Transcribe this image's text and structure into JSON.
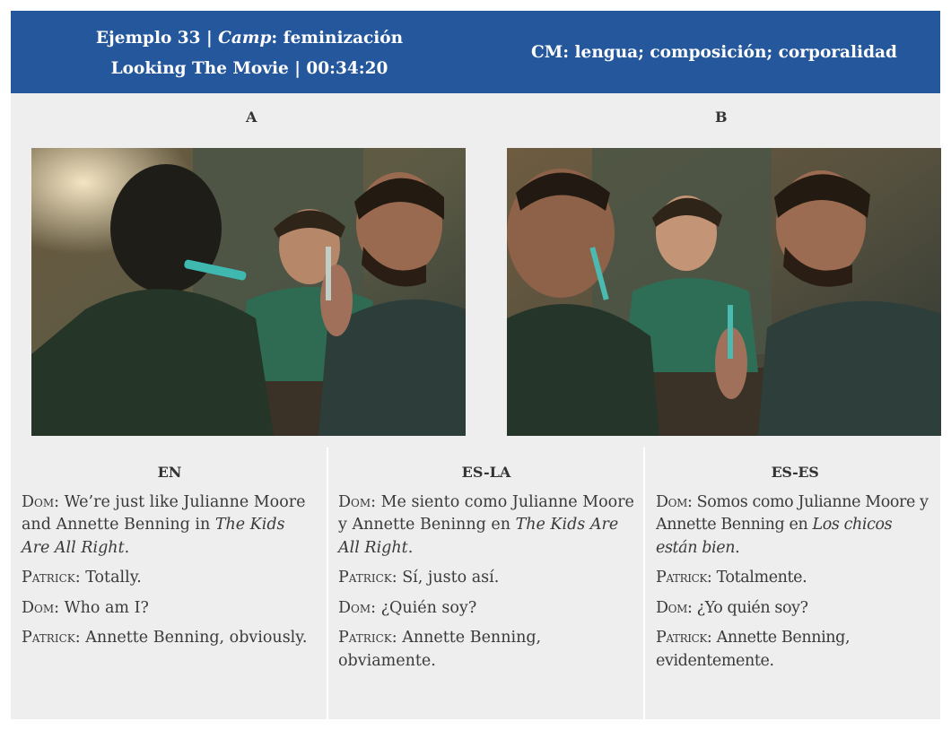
{
  "header": {
    "line1_prefix": "Ejemplo 33 | ",
    "line1_italic": "Camp",
    "line1_suffix": ": feminización",
    "line2": "Looking The Movie | 00:34:20",
    "cm": "CM: lengua; composición; corporalidad"
  },
  "panels": [
    {
      "label": "A"
    },
    {
      "label": "B"
    }
  ],
  "columns": [
    {
      "header": "EN",
      "lines": [
        {
          "speaker": "Dom",
          "text": "We’re just like Julianne Moore and Annette Benning in ",
          "italic": "The Kids Are All Right",
          "end": "."
        },
        {
          "speaker": "Patrick",
          "text": "Totally.",
          "italic": "",
          "end": ""
        },
        {
          "speaker": "Dom",
          "text": "Who am I?",
          "italic": "",
          "end": ""
        },
        {
          "speaker": "Patrick",
          "text": "Annette Benning, obviously.",
          "italic": "",
          "end": ""
        }
      ]
    },
    {
      "header": "ES-LA",
      "lines": [
        {
          "speaker": "Dom",
          "text": "Me siento como Julianne Moore y Annette Beninng en ",
          "italic": "The Kids Are All Right",
          "end": "."
        },
        {
          "speaker": "Patrick",
          "text": "Sí, justo así.",
          "italic": "",
          "end": ""
        },
        {
          "speaker": "Dom",
          "text": "¿Quién soy?",
          "italic": "",
          "end": ""
        },
        {
          "speaker": "Patrick",
          "text": "Annette Benning, obviamente.",
          "italic": "",
          "end": ""
        }
      ]
    },
    {
      "header": "ES-ES",
      "lines": [
        {
          "speaker": "Dom",
          "text": "Somos como Julianne Moore y Annette Benning en ",
          "italic": "Los chicos están bien",
          "end": "."
        },
        {
          "speaker": "Patrick",
          "text": "Totalmente.",
          "italic": "",
          "end": ""
        },
        {
          "speaker": "Dom",
          "text": "¿Yo quién soy?",
          "italic": "",
          "end": ""
        },
        {
          "speaker": "Patrick",
          "text": "Annette Benning, evidentemente.",
          "italic": "",
          "end": ""
        }
      ]
    }
  ]
}
